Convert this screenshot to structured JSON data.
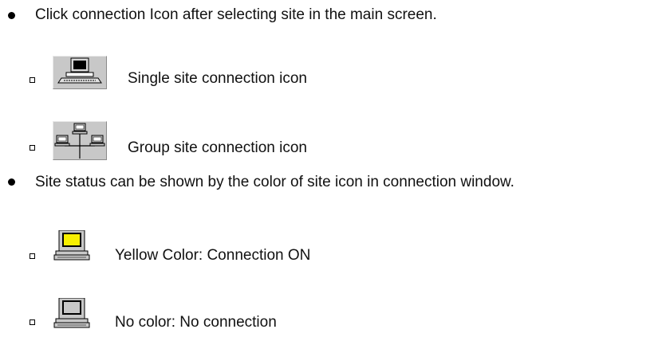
{
  "section1": {
    "text": "Click connection Icon after selecting site in the main screen.",
    "items": [
      {
        "icon": "single-site-connection-icon",
        "label": "Single site connection icon"
      },
      {
        "icon": "group-site-connection-icon",
        "label": "Group site connection icon"
      }
    ]
  },
  "section2": {
    "text": "Site status can be shown by the color of site icon in connection window.",
    "items": [
      {
        "icon": "site-connected-icon",
        "label": "Yellow Color: Connection ON",
        "screen_color": "#f7ef00"
      },
      {
        "icon": "site-disconnected-icon",
        "label": "No color: No connection",
        "screen_color": "#c8c8c8"
      }
    ]
  }
}
